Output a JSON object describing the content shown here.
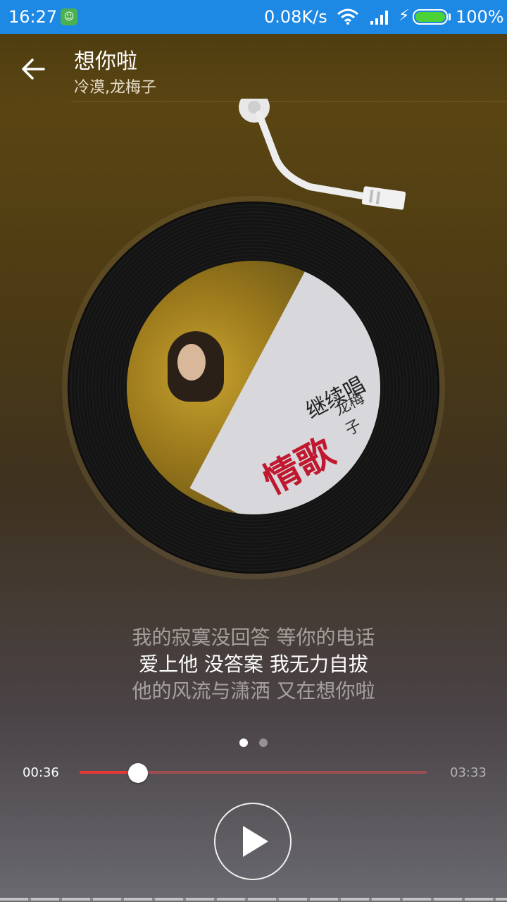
{
  "status_bar": {
    "time": "16:27",
    "network_speed": "0.08K/s",
    "battery_percent": "100%",
    "battery_level": 1.0,
    "icons": [
      "notification-app-icon",
      "wifi-icon",
      "signal-icon",
      "charging-icon",
      "battery-icon"
    ]
  },
  "header": {
    "back_icon": "arrow-left-icon",
    "title": "想你啦",
    "artist": "冷漠,龙梅子"
  },
  "album": {
    "title_text": "情歌",
    "subtitle_text": "继续唱",
    "artist_text": "龙梅子"
  },
  "lyrics": {
    "previous": "我的寂寞没回答 等你的电话",
    "current": "爱上他 没答案 我无力自拔",
    "next": "他的风流与潇洒 又在想你啦"
  },
  "pager": {
    "count": 2,
    "active_index": 0
  },
  "player": {
    "current_time": "00:36",
    "total_time": "03:33",
    "progress": 0.169,
    "play_icon": "play-icon",
    "accent_color": "#e53935"
  }
}
